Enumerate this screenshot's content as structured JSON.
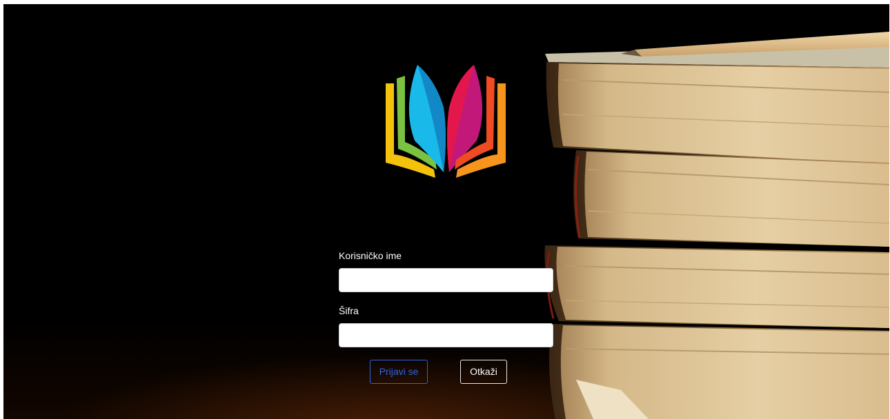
{
  "login": {
    "username_label": "Korisničko ime",
    "username_value": "",
    "password_label": "Šifra",
    "password_value": "",
    "login_button": "Prijavi se",
    "cancel_button": "Otkaži"
  },
  "colors": {
    "background": "#000000",
    "primary_button": "#2f66e0",
    "cancel_button": "#ffffff",
    "input_background": "#ffffff"
  },
  "icons": {
    "logo": "open-book-logo-icon",
    "background": "book-stack-image"
  }
}
